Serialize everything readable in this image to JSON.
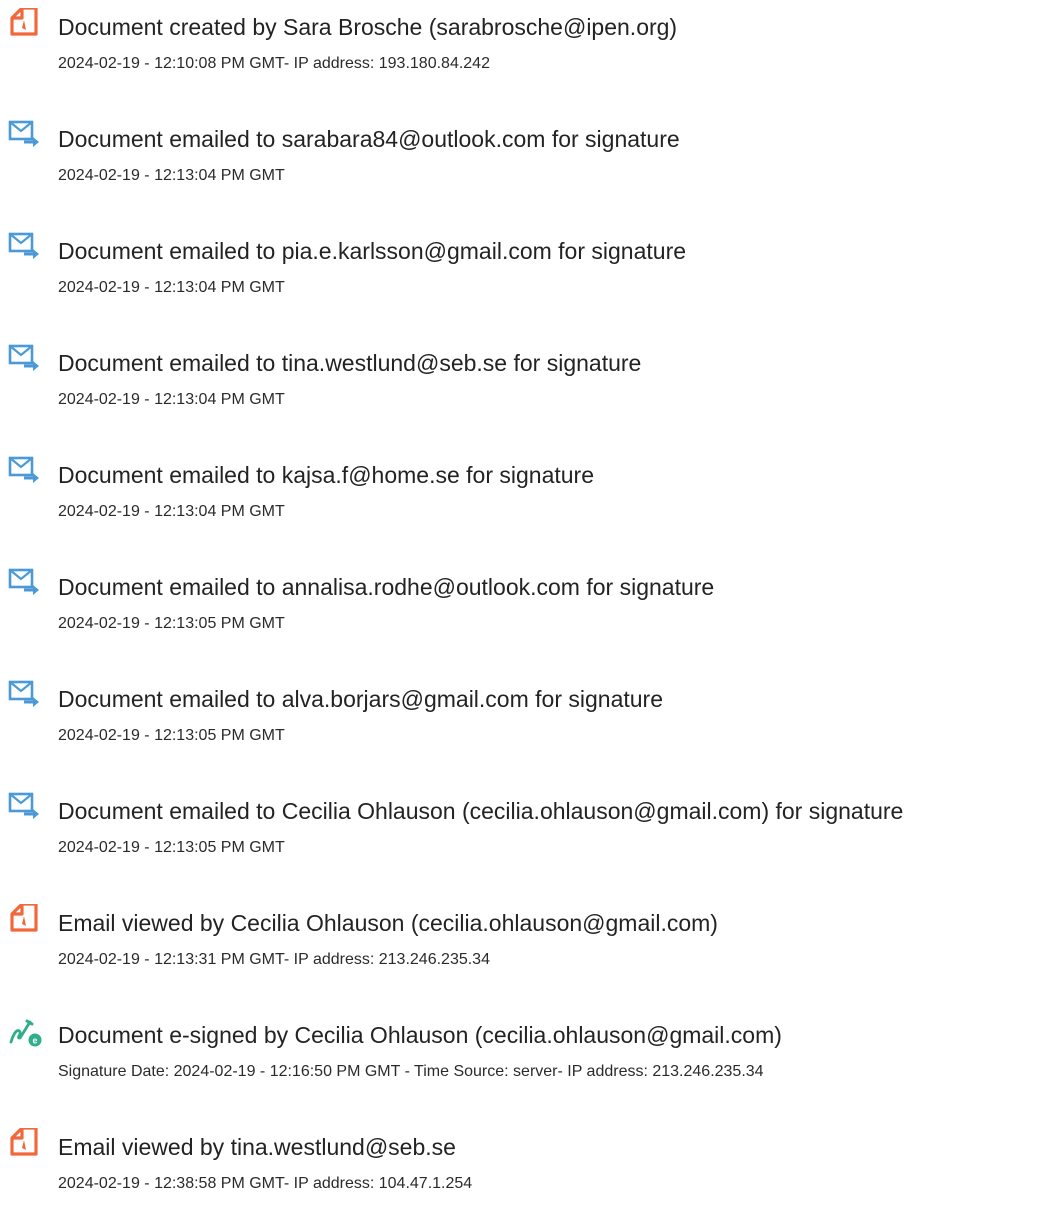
{
  "events": [
    {
      "icon": "document-created-icon",
      "title": "Document created by Sara Brosche (sarabrosche@ipen.org)",
      "detail": "2024-02-19 - 12:10:08 PM GMT- IP address: 193.180.84.242"
    },
    {
      "icon": "email-sent-icon",
      "title": "Document emailed to sarabara84@outlook.com for signature",
      "detail": "2024-02-19 - 12:13:04 PM GMT"
    },
    {
      "icon": "email-sent-icon",
      "title": "Document emailed to pia.e.karlsson@gmail.com for signature",
      "detail": "2024-02-19 - 12:13:04 PM GMT"
    },
    {
      "icon": "email-sent-icon",
      "title": "Document emailed to tina.westlund@seb.se for signature",
      "detail": "2024-02-19 - 12:13:04 PM GMT"
    },
    {
      "icon": "email-sent-icon",
      "title": "Document emailed to kajsa.f@home.se for signature",
      "detail": "2024-02-19 - 12:13:04 PM GMT"
    },
    {
      "icon": "email-sent-icon",
      "title": "Document emailed to annalisa.rodhe@outlook.com for signature",
      "detail": "2024-02-19 - 12:13:05 PM GMT"
    },
    {
      "icon": "email-sent-icon",
      "title": "Document emailed to alva.borjars@gmail.com for signature",
      "detail": "2024-02-19 - 12:13:05 PM GMT"
    },
    {
      "icon": "email-sent-icon",
      "title": "Document emailed to Cecilia Ohlauson (cecilia.ohlauson@gmail.com) for signature",
      "detail": "2024-02-19 - 12:13:05 PM GMT"
    },
    {
      "icon": "email-viewed-icon",
      "title": "Email viewed by Cecilia Ohlauson (cecilia.ohlauson@gmail.com)",
      "detail": "2024-02-19 - 12:13:31 PM GMT- IP address: 213.246.235.34"
    },
    {
      "icon": "e-signed-icon",
      "title": "Document e-signed by Cecilia Ohlauson (cecilia.ohlauson@gmail.com)",
      "detail": "Signature Date: 2024-02-19 - 12:16:50 PM GMT - Time Source: server- IP address: 213.246.235.34"
    },
    {
      "icon": "email-viewed-icon",
      "title": "Email viewed by tina.westlund@seb.se",
      "detail": "2024-02-19 - 12:38:58 PM GMT- IP address: 104.47.1.254"
    }
  ],
  "colors": {
    "document_icon": "#f0683c",
    "email_icon": "#4a9ad8",
    "esign_icon": "#2fae8c"
  }
}
